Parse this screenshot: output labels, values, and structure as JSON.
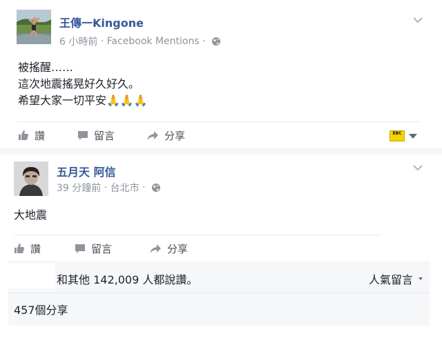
{
  "post1": {
    "author": "王傳一Kingone",
    "time": "6 小時前",
    "separator": "·",
    "source": "Facebook Mentions",
    "lines": [
      "被搖醒……",
      "這次地震搖晃好久好久。",
      "希望大家一切平安🙏🙏🙏"
    ],
    "actions": {
      "like": "讚",
      "comment": "留言",
      "share": "分享"
    },
    "page_badge": "EBC"
  },
  "post2": {
    "author": "五月天 阿信",
    "time": "39 分鐘前",
    "separator": "·",
    "location": "台北市",
    "text": "大地震",
    "actions": {
      "like": "讚",
      "comment": "留言",
      "share": "分享"
    }
  },
  "summary": {
    "likes": "和其他 142,009 人都說讚。",
    "sort_label": "人氣留言",
    "shares": "457個分享"
  },
  "colors": {
    "link": "#365899",
    "meta": "#90949c",
    "action": "#4b4f56",
    "badge": "#f5d300"
  },
  "icons": [
    "chevron-down-icon",
    "globe-icon",
    "like-icon",
    "comment-icon",
    "share-icon",
    "caret-down-icon"
  ]
}
